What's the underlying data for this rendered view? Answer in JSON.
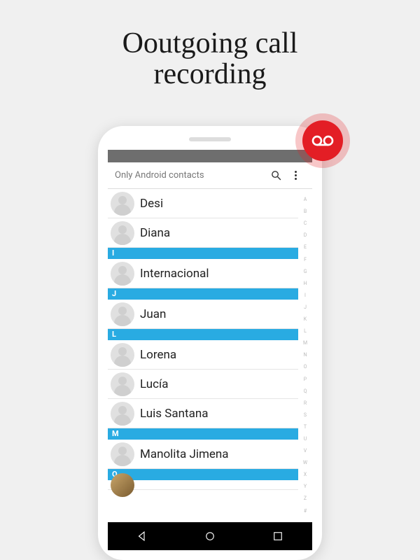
{
  "promo": {
    "title_line1": "Ooutgoing call",
    "title_line2": "recording"
  },
  "app_bar": {
    "title": "Only Android contacts"
  },
  "contacts": {
    "ungrouped": [
      {
        "name": "Desi"
      },
      {
        "name": "Diana"
      }
    ],
    "sections": [
      {
        "letter": "I",
        "items": [
          {
            "name": "Internacional"
          }
        ]
      },
      {
        "letter": "J",
        "items": [
          {
            "name": "Juan"
          }
        ]
      },
      {
        "letter": "L",
        "items": [
          {
            "name": "Lorena"
          },
          {
            "name": "Lucía"
          },
          {
            "name": "Luis Santana"
          }
        ]
      },
      {
        "letter": "M",
        "items": [
          {
            "name": "Manolita Jimena"
          }
        ]
      },
      {
        "letter": "O",
        "items": []
      }
    ]
  },
  "index_letters": [
    "A",
    "B",
    "C",
    "D",
    "E",
    "F",
    "G",
    "H",
    "I",
    "J",
    "K",
    "L",
    "M",
    "N",
    "O",
    "P",
    "Q",
    "R",
    "S",
    "T",
    "U",
    "V",
    "W",
    "X",
    "Y",
    "Z",
    "#"
  ],
  "icons": {
    "search": "search-icon",
    "overflow": "overflow-menu-icon",
    "record": "voicemail-record-icon",
    "nav_back": "nav-back-icon",
    "nav_home": "nav-home-icon",
    "nav_recent": "nav-recent-icon"
  },
  "colors": {
    "section_header": "#29abe2",
    "record_badge": "#e31e25"
  }
}
